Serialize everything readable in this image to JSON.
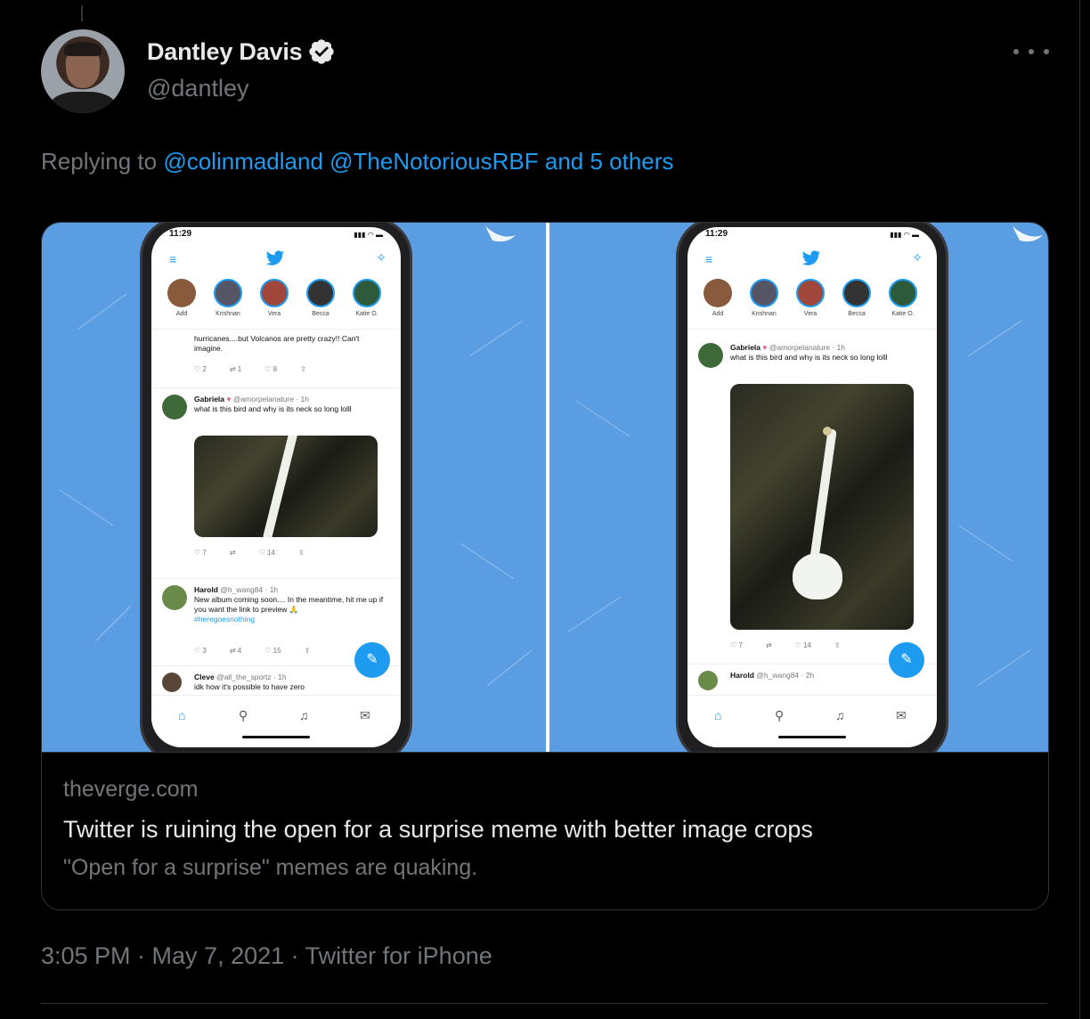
{
  "tweet": {
    "display_name": "Dantley Davis",
    "handle": "@dantley",
    "reply_prefix": "Replying to",
    "reply_mentions": [
      "@colinmadland",
      "@TheNotoriousRBF"
    ],
    "reply_others": "and 5 others",
    "timestamp": "3:05 PM · May 7, 2021 · Twitter for iPhone"
  },
  "card": {
    "domain": "theverge.com",
    "title": "Twitter is ruining the open for a surprise meme with better image crops",
    "description": "\"Open for a surprise\" memes are quaking."
  },
  "phone_left": {
    "time": "11:29",
    "fleets": [
      "Add",
      "Krishnan",
      "Vera",
      "Becca",
      "Katie O."
    ],
    "prev_tweet_text": "hurricanes....but Volcanos are pretty crazy!!  Can't imagine.",
    "prev_actions": [
      "2",
      "1",
      "8",
      ""
    ],
    "tweet1_name": "Gabriela",
    "tweet1_handle": "@amorpelanature · 1h",
    "tweet1_text": "what is this bird and why is its neck so long lolll",
    "tweet1_actions": [
      "7",
      "",
      "14",
      ""
    ],
    "tweet2_name": "Harold",
    "tweet2_handle": "@h_wang84 · 1h",
    "tweet2_text": "New album coming soon.... In the meantime, hit me up if you want the link to preview 🙏",
    "tweet2_tag": "#heregoesnothing",
    "tweet2_actions": [
      "3",
      "4",
      "15",
      ""
    ],
    "tweet3_name": "Cleve",
    "tweet3_handle": "@all_the_sportz · 1h",
    "tweet3_text": "idk how it's possible to have zero"
  },
  "phone_right": {
    "time": "11:29",
    "fleets": [
      "Add",
      "Krishnan",
      "Vera",
      "Becca",
      "Katie O."
    ],
    "tweet1_name": "Gabriela",
    "tweet1_handle": "@amorpelanature · 1h",
    "tweet1_text": "what is this bird and why is its neck so long lolll",
    "tweet1_actions": [
      "7",
      "",
      "14",
      ""
    ],
    "tweet2_name": "Harold",
    "tweet2_handle": "@h_wang84 · 2h"
  },
  "colors": {
    "background": "#000000",
    "text_primary": "#e7e9ea",
    "text_secondary": "#71767b",
    "link": "#1d9bf0",
    "card_border": "#2f3336",
    "media_blue": "#5b9de3"
  },
  "icons": [
    "verified-badge-icon",
    "more-options-icon",
    "twitter-bird-icon",
    "home-icon",
    "search-icon",
    "notifications-icon",
    "messages-icon",
    "compose-icon",
    "sparkle-icon",
    "menu-icon"
  ]
}
